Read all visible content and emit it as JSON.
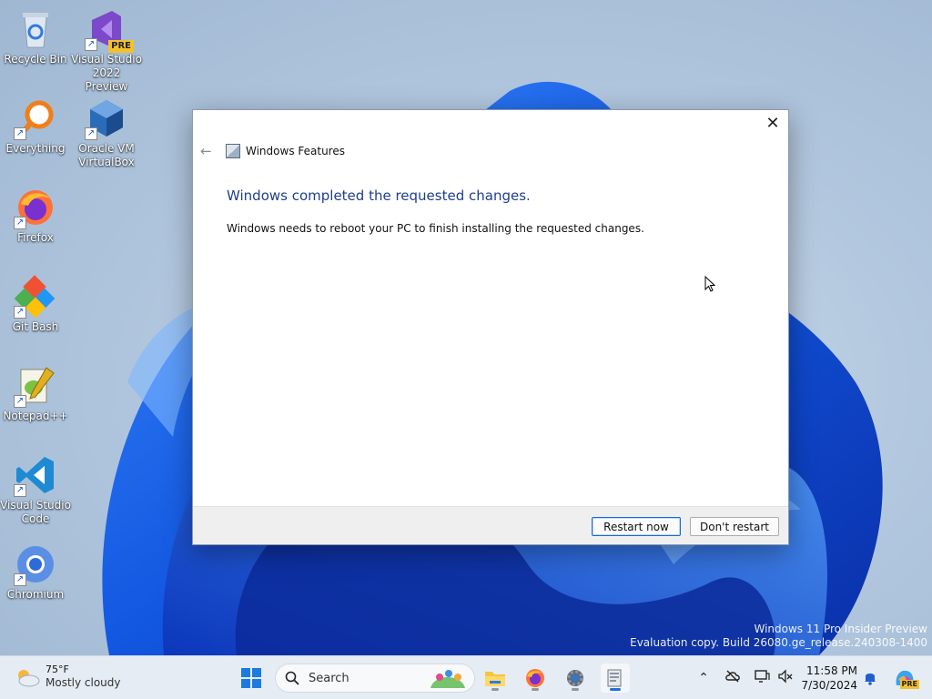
{
  "desktop": {
    "icons": [
      {
        "label": "Recycle Bin"
      },
      {
        "label": "Visual Studio 2022 Preview",
        "badge": "PRE"
      },
      {
        "label": "Everything"
      },
      {
        "label": "Oracle VM VirtualBox"
      },
      {
        "label": "Firefox"
      },
      {
        "label": "Git Bash"
      },
      {
        "label": "Notepad++"
      },
      {
        "label": "Visual Studio Code"
      },
      {
        "label": "Chromium"
      }
    ],
    "watermark": {
      "line1": "Windows 11 Pro Insider Preview",
      "line2": "Evaluation copy. Build 26080.ge_release.240308-1400"
    }
  },
  "dialog": {
    "window_title": "Windows Features",
    "heading": "Windows completed the requested changes.",
    "message": "Windows needs to reboot your PC to finish installing the requested changes.",
    "restart_label": "Restart now",
    "dont_restart_label": "Don't restart",
    "close_glyph": "✕",
    "back_glyph": "←"
  },
  "taskbar": {
    "weather": {
      "temp": "75°F",
      "condition": "Mostly cloudy"
    },
    "search_placeholder": "Search",
    "apps": [
      "start-icon",
      "file-explorer-icon",
      "firefox-icon",
      "settings-icon",
      "windows-features-icon"
    ],
    "active_app": "windows-features-icon",
    "clock": {
      "time": "11:58 PM",
      "date": "7/30/2024"
    },
    "copilot_badge": "PRE"
  },
  "colors": {
    "heading_blue": "#1f3e8e",
    "accent": "#1f6fd6",
    "taskbar_bg": "#e6ecf3"
  }
}
